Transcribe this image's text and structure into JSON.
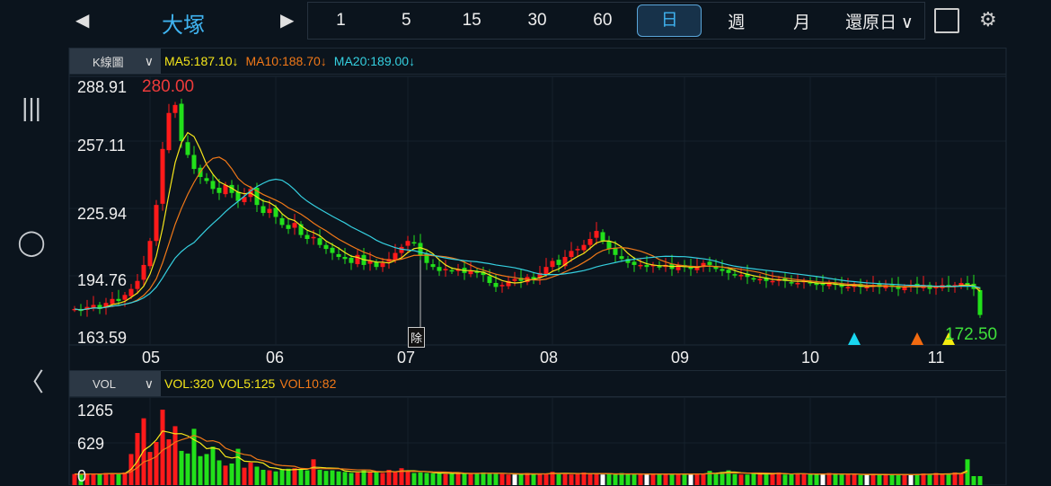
{
  "topbar": {
    "prev": "◀",
    "next": "▶",
    "stock_name": "大塚",
    "periods": [
      "1",
      "5",
      "15",
      "30",
      "60",
      "日",
      "週",
      "月"
    ],
    "active_period": "日",
    "adjust": "還原日",
    "adjust_chevron": "∨"
  },
  "kline": {
    "selector": "K線圖",
    "chevron": "∨",
    "ma5": "MA5:187.10↓",
    "ma10": "MA10:188.70↓",
    "ma20": "MA20:189.00↓",
    "y_max": "288.91",
    "y_2": "257.11",
    "y_3": "225.94",
    "y_4": "194.76",
    "y_min": "163.59",
    "high_label": "280.00",
    "last_label": "172.50",
    "ex_div": "除"
  },
  "volume": {
    "selector": "VOL",
    "chevron": "∨",
    "vol": "VOL:320",
    "vol5": "VOL5:125",
    "vol10": "VOL10:82",
    "y_max": "1265",
    "y_mid": "629",
    "y_min": "0"
  },
  "months": [
    "05",
    "06",
    "07",
    "08",
    "09",
    "10",
    "11"
  ],
  "colors": {
    "up": "#ff1a1a",
    "down": "#22e01a",
    "ma5": "#f5e61a",
    "ma10": "#f07818",
    "ma20": "#35d0e0",
    "title": "#3fb3f0"
  },
  "chart_data": {
    "type": "candlestick",
    "ylim": [
      163.59,
      288.91
    ],
    "vol_ylim": [
      0,
      1265
    ],
    "month_start_index": [
      12,
      32,
      53,
      76,
      97,
      117,
      137
    ],
    "ex_div_index": 55,
    "markers": [
      {
        "index": 124,
        "color": "#19d6f0"
      },
      {
        "index": 134,
        "color": "#f26a10"
      },
      {
        "index": 139,
        "color": "#f5ec10"
      }
    ],
    "closes": [
      178,
      177,
      179,
      180,
      178,
      181,
      183,
      182,
      185,
      188,
      192,
      200,
      212,
      230,
      258,
      276,
      280,
      262,
      255,
      248,
      244,
      242,
      238,
      236,
      240,
      236,
      232,
      234,
      238,
      230,
      226,
      228,
      224,
      220,
      218,
      221,
      215,
      213,
      214,
      210,
      208,
      206,
      204,
      203,
      201,
      205,
      200,
      202,
      199,
      201,
      203,
      206,
      209,
      212,
      211,
      205,
      201,
      199,
      197,
      198,
      197,
      198,
      196,
      197,
      196,
      195,
      191,
      189,
      190,
      192,
      193,
      192,
      194,
      193,
      196,
      199,
      202,
      200,
      204,
      207,
      208,
      210,
      213,
      217,
      212,
      208,
      205,
      203,
      201,
      200,
      200,
      199,
      200,
      199,
      200,
      198,
      200,
      199,
      198,
      199,
      201,
      200,
      198,
      197,
      196,
      195,
      195,
      194,
      193,
      193,
      192,
      192,
      193,
      192,
      191,
      191,
      192,
      191,
      190,
      190,
      191,
      190,
      189,
      189,
      190,
      189,
      189,
      190,
      189,
      190,
      189,
      188,
      189,
      190,
      189,
      190,
      188,
      189,
      190,
      189,
      190,
      191,
      190,
      188,
      175
    ],
    "volumes": [
      40,
      30,
      50,
      45,
      35,
      60,
      55,
      40,
      70,
      420,
      820,
      1100,
      460,
      650,
      1265,
      700,
      950,
      480,
      430,
      900,
      380,
      420,
      560,
      300,
      200,
      240,
      520,
      160,
      260,
      180,
      120,
      110,
      90,
      130,
      140,
      150,
      130,
      110,
      320,
      120,
      100,
      110,
      90,
      80,
      60,
      70,
      110,
      90,
      70,
      60,
      120,
      80,
      150,
      90,
      60,
      70,
      60,
      50,
      60,
      40,
      50,
      60,
      50,
      40,
      50,
      70,
      60,
      50,
      40,
      30,
      30,
      40,
      60,
      30,
      40,
      50,
      80,
      60,
      40,
      30,
      40,
      70,
      50,
      40,
      30,
      40,
      30,
      60,
      40,
      30,
      40,
      30,
      50,
      40,
      30,
      40,
      50,
      40,
      30,
      50,
      40,
      100,
      60,
      80,
      110,
      40,
      30,
      30,
      60,
      50,
      30,
      40,
      70,
      30,
      40,
      50,
      40,
      30,
      40,
      30,
      60,
      40,
      30,
      40,
      30,
      20,
      30,
      40,
      30,
      20,
      30,
      30,
      40,
      20,
      30,
      50,
      40,
      60,
      30,
      40,
      70,
      60,
      320
    ]
  }
}
